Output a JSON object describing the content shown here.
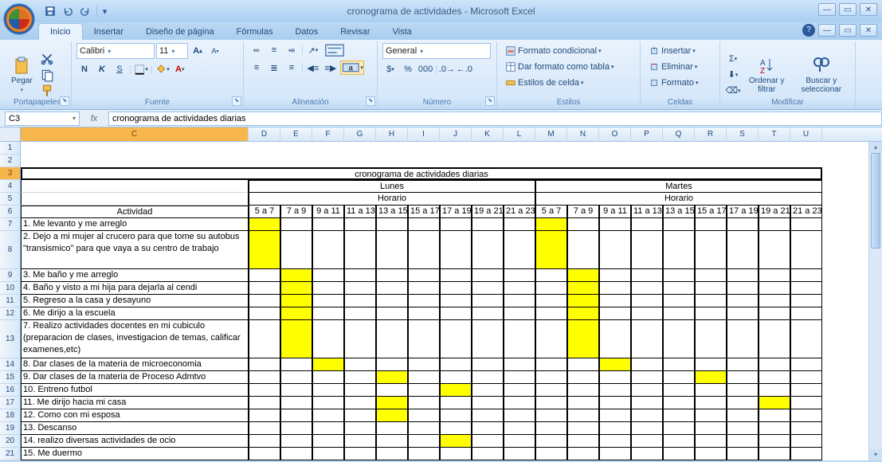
{
  "app": {
    "title": "cronograma de actividades - Microsoft Excel"
  },
  "tabs": {
    "inicio": "Inicio",
    "insertar": "Insertar",
    "diseno": "Diseño de página",
    "formulas": "Fórmulas",
    "datos": "Datos",
    "revisar": "Revisar",
    "vista": "Vista"
  },
  "ribbon": {
    "groups": {
      "portapapeles": "Portapapeles",
      "fuente": "Fuente",
      "alineacion": "Alineación",
      "numero": "Número",
      "estilos": "Estilos",
      "celdas": "Celdas",
      "modificar": "Modificar"
    },
    "pegar": "Pegar",
    "font_name": "Calibri",
    "font_size": "11",
    "number_format": "General",
    "formato_cond": "Formato condicional",
    "dar_formato": "Dar formato como tabla",
    "estilos_celda": "Estilos de celda",
    "insertar": "Insertar",
    "eliminar": "Eliminar",
    "formato": "Formato",
    "ordenar": "Ordenar y filtrar",
    "buscar": "Buscar y seleccionar"
  },
  "formula_bar": {
    "cell_ref": "C3",
    "formula": "cronograma de actividades diarias"
  },
  "columns": [
    "C",
    "D",
    "E",
    "F",
    "G",
    "H",
    "I",
    "J",
    "K",
    "L",
    "M",
    "N",
    "O",
    "P",
    "Q",
    "R",
    "S",
    "T",
    "U"
  ],
  "chart_data": {
    "type": "table",
    "title": "cronograma de actividades diarias",
    "days": [
      "Lunes",
      "Martes"
    ],
    "horario_label": "Horario",
    "actividad_label": "Actividad",
    "time_slots": [
      "5 a 7",
      "7 a 9",
      "9 a 11",
      "11 a 13",
      "13 a 15",
      "15 a 17",
      "17 a 19",
      "19 a 21",
      "21 a 23"
    ],
    "activities": [
      {
        "text": "1. Me levanto y me arreglo",
        "lunes": [
          0
        ],
        "martes": [
          0
        ]
      },
      {
        "text": "2. Dejo a mi mujer al crucero para que tome su autobus \"transismico\" para que vaya a su centro de trabajo",
        "lunes": [
          0
        ],
        "martes": [
          0
        ]
      },
      {
        "text": "3. Me baño y me arreglo",
        "lunes": [
          1
        ],
        "martes": [
          1
        ]
      },
      {
        "text": "4. Baño y visto a mi hija para dejarla al cendi",
        "lunes": [
          1
        ],
        "martes": [
          1
        ]
      },
      {
        "text": "5. Regreso a la casa y desayuno",
        "lunes": [
          1
        ],
        "martes": [
          1
        ]
      },
      {
        "text": "6. Me dirijo a la escuela",
        "lunes": [
          1
        ],
        "martes": [
          1
        ]
      },
      {
        "text": "7. Realizo actividades docentes en mi cubiculo (preparacion de clases, investigacion de temas, calificar examenes,etc)",
        "lunes": [
          1
        ],
        "martes": [
          1
        ]
      },
      {
        "text": "8. Dar clases de la materia de microeconomia",
        "lunes": [
          2
        ],
        "martes": [
          2
        ]
      },
      {
        "text": "9. Dar clases de la materia de Proceso Admtvo",
        "lunes": [
          4
        ],
        "martes": [
          5
        ]
      },
      {
        "text": "10. Entreno futbol",
        "lunes": [
          6
        ],
        "martes": []
      },
      {
        "text": "11. Me dirijo hacia mi casa",
        "lunes": [
          4
        ],
        "martes": [
          7
        ]
      },
      {
        "text": "12. Como con mi esposa",
        "lunes": [
          4
        ],
        "martes": []
      },
      {
        "text": "13. Descanso",
        "lunes": [],
        "martes": []
      },
      {
        "text": "14. realizo diversas actividades de ocio",
        "lunes": [
          6
        ],
        "martes": []
      },
      {
        "text": "15. Me duermo",
        "lunes": [],
        "martes": []
      }
    ]
  }
}
